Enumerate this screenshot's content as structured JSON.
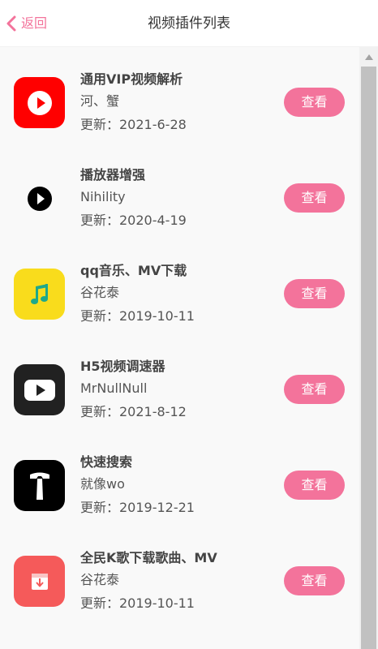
{
  "header": {
    "back_icon": "chevron-left-icon",
    "back_label": "返回",
    "title": "视频插件列表"
  },
  "colors": {
    "accent": "#f3739b",
    "list_background": "#f9f9f9",
    "scroll_thumb": "#c1c1c1"
  },
  "plugins": [
    {
      "name": "通用VIP视频解析",
      "author": "河、蟹",
      "updated": "更新：2021-6-28",
      "button": "查看",
      "icon": "youtube-red-play-icon",
      "icon_color": "#ff0000"
    },
    {
      "name": "播放器增强",
      "author": "Nihility",
      "updated": "更新：2020-4-19",
      "button": "查看",
      "icon": "black-play-circle-icon",
      "icon_color": "#000000"
    },
    {
      "name": "qq音乐、MV下载",
      "author": "谷花泰",
      "updated": "更新：2019-10-11",
      "button": "查看",
      "icon": "music-note-icon",
      "icon_color": "#f9dc1c"
    },
    {
      "name": "H5视频调速器",
      "author": "MrNullNull",
      "updated": "更新：2021-8-12",
      "button": "查看",
      "icon": "youtube-dark-play-icon",
      "icon_color": "#212121"
    },
    {
      "name": "快速搜索",
      "author": "就像wo",
      "updated": "更新：2019-12-21",
      "button": "查看",
      "icon": "hammer-icon",
      "icon_color": "#000000"
    },
    {
      "name": "全民K歌下载歌曲、MV",
      "author": "谷花泰",
      "updated": "更新：2019-10-11",
      "button": "查看",
      "icon": "download-box-icon",
      "icon_color": "#f55a5a"
    }
  ],
  "scrollbar": {
    "up_arrow_icon": "scroll-up-arrow-icon"
  }
}
